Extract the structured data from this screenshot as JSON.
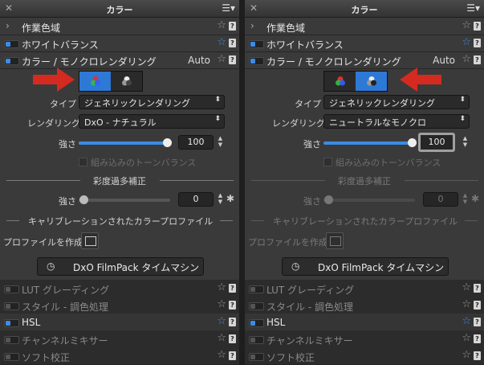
{
  "panels": {
    "left": {
      "title": "カラー",
      "items": {
        "workspace": "作業色域",
        "white_balance": "ホワイトバランス",
        "color_render": "カラー / モノクロレンダリング",
        "auto": "Auto",
        "type_label": "タイプ",
        "type_value": "ジェネリックレンダリング",
        "rendering_label": "レンダリング",
        "rendering_value": "DxO - ナチュラル",
        "strength_label": "強さ",
        "strength_value": "100",
        "tone_balance": "組み込みのトーンバランス",
        "saturation_section": "彩度過多補正",
        "sat_strength_label": "強さ",
        "sat_strength_value": "0",
        "calib_section": "キャリブレーションされたカラープロファイル",
        "create_profile": "プロファイルを作成",
        "filmpack": "DxO FilmPack タイムマシン",
        "lut": "LUT グレーディング",
        "style": "スタイル - 調色処理",
        "hsl": "HSL",
        "channel_mixer": "チャンネルミキサー",
        "soft_proof": "ソフト校正"
      },
      "mode": "color",
      "strength_level": 100,
      "sat_strength_level": 0
    },
    "right": {
      "title": "カラー",
      "items": {
        "workspace": "作業色域",
        "white_balance": "ホワイトバランス",
        "color_render": "カラー / モノクロレンダリング",
        "auto": "Auto",
        "type_label": "タイプ",
        "type_value": "ジェネリックレンダリング",
        "rendering_label": "レンダリング",
        "rendering_value": "ニュートラルなモノクロ",
        "strength_label": "強さ",
        "strength_value": "100",
        "tone_balance": "組み込みのトーンバランス",
        "saturation_section": "彩度過多補正",
        "sat_strength_label": "強さ",
        "sat_strength_value": "0",
        "calib_section": "キャリブレーションされたカラープロファイル",
        "create_profile": "プロファイルを作成",
        "filmpack": "DxO FilmPack タイムマシン",
        "lut": "LUT グレーディング",
        "style": "スタイル - 調色処理",
        "hsl": "HSL",
        "channel_mixer": "チャンネルミキサー",
        "soft_proof": "ソフト校正"
      },
      "mode": "monochrome",
      "strength_level": 100,
      "sat_strength_level": 0
    }
  },
  "icons": {
    "close": "close-icon",
    "menu": "menu-icon",
    "star": "star-icon",
    "help": "help-icon",
    "wand": "magic-wand-icon"
  },
  "colors": {
    "accent": "#3c8be6",
    "arrow": "#d42a20",
    "panel_bg": "#3a3a3a"
  }
}
